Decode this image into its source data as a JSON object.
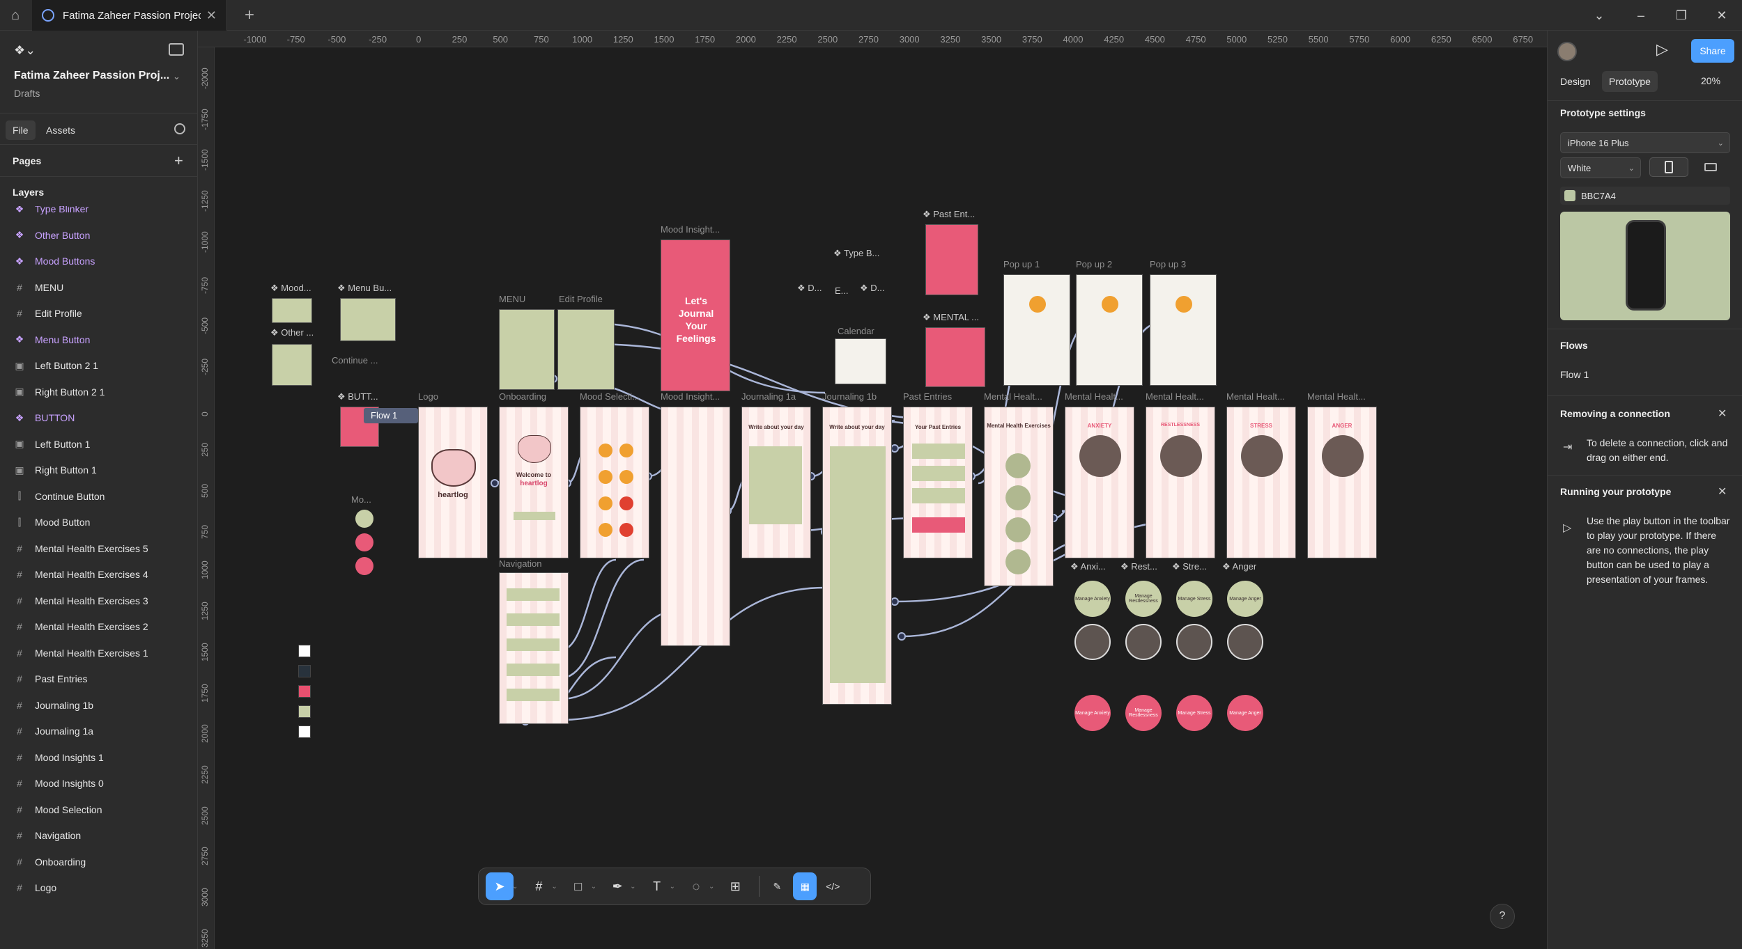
{
  "titlebar": {
    "tab_title": "Fatima Zaheer Passion Project G",
    "win_min": "–",
    "win_restore": "❐",
    "win_close": "✕",
    "win_dropdown": "⌄"
  },
  "left_panel": {
    "file_title": "Fatima Zaheer Passion Proj...",
    "file_subtitle": "Drafts",
    "tabs": [
      "File",
      "Assets"
    ],
    "pages_label": "Pages",
    "layers_label": "Layers",
    "layers": [
      {
        "name": "Type Blinker",
        "type": "component"
      },
      {
        "name": "Other Button",
        "type": "component"
      },
      {
        "name": "Mood Buttons",
        "type": "component"
      },
      {
        "name": "MENU",
        "type": "frame"
      },
      {
        "name": "Edit Profile",
        "type": "frame"
      },
      {
        "name": "Menu Button",
        "type": "component"
      },
      {
        "name": "Left Button 2 1",
        "type": "group"
      },
      {
        "name": "Right Button 2 1",
        "type": "group"
      },
      {
        "name": "BUTTON",
        "type": "component"
      },
      {
        "name": "Left Button 1",
        "type": "group"
      },
      {
        "name": "Right Button 1",
        "type": "group"
      },
      {
        "name": "Continue Button",
        "type": "autolayout"
      },
      {
        "name": "Mood Button",
        "type": "autolayout"
      },
      {
        "name": "Mental Health Exercises 5",
        "type": "frame"
      },
      {
        "name": "Mental Health Exercises 4",
        "type": "frame"
      },
      {
        "name": "Mental Health Exercises 3",
        "type": "frame"
      },
      {
        "name": "Mental Health Exercises 2",
        "type": "frame"
      },
      {
        "name": "Mental Health Exercises 1",
        "type": "frame"
      },
      {
        "name": "Past Entries",
        "type": "frame"
      },
      {
        "name": "Journaling 1b",
        "type": "frame"
      },
      {
        "name": "Journaling 1a",
        "type": "frame"
      },
      {
        "name": "Mood Insights 1",
        "type": "frame"
      },
      {
        "name": "Mood Insights 0",
        "type": "frame"
      },
      {
        "name": "Mood Selection",
        "type": "frame"
      },
      {
        "name": "Navigation",
        "type": "frame"
      },
      {
        "name": "Onboarding",
        "type": "frame"
      },
      {
        "name": "Logo",
        "type": "frame"
      }
    ]
  },
  "canvas": {
    "ruler_top": [
      "-1000",
      "-750",
      "-500",
      "-250",
      "0",
      "250",
      "500",
      "750",
      "1000",
      "1250",
      "1500",
      "1750",
      "2000",
      "2250",
      "2500",
      "2750",
      "3000",
      "3250",
      "3500",
      "3750",
      "4000",
      "4250",
      "4500",
      "4750",
      "5000",
      "5250",
      "5500",
      "5750",
      "6000",
      "6250",
      "6500",
      "6750"
    ],
    "ruler_left": [
      "-2000",
      "-1750",
      "-1500",
      "-1250",
      "-1000",
      "-750",
      "-500",
      "-250",
      "0",
      "250",
      "500",
      "750",
      "1000",
      "1250",
      "1500",
      "1750",
      "2000",
      "2250",
      "2500",
      "2750",
      "3000",
      "3250"
    ],
    "flow_badge": "Flow 1",
    "frame_labels": {
      "logo": "Logo",
      "onboarding": "Onboarding",
      "mood_selection": "Mood Selecti...",
      "mood_insights": "Mood Insight...",
      "mood_insights_top": "Mood Insight...",
      "journaling_1a": "Journaling 1a",
      "journaling_1b": "Journaling 1b",
      "past_entries": "Past Entries",
      "mh1": "Mental Healt...",
      "mh2": "Mental Healt...",
      "mh3": "Mental Healt...",
      "mh4": "Mental Healt...",
      "mh5": "Mental Healt...",
      "menu": "MENU",
      "edit_profile": "Edit Profile",
      "navigation": "Navigation",
      "calendar": "Calendar",
      "popup1": "Pop up 1",
      "popup2": "Pop up 2",
      "popup3": "Pop up 3",
      "continue": "Continue ...",
      "mo": "Mo..."
    },
    "component_labels": {
      "mood": "❖ Mood...",
      "menu_bu": "❖ Menu Bu...",
      "other": "❖ Other ...",
      "butt": "❖ BUTT...",
      "past_ent": "❖ Past Ent...",
      "mental": "❖ MENTAL ...",
      "type_b": "❖ Type B...",
      "d1": "❖ D...",
      "d2": "❖ D...",
      "e": "E...",
      "anxi": "❖ Anxi...",
      "rest": "❖ Rest...",
      "stre": "❖ Stre...",
      "anger": "❖ Anger"
    },
    "frame_texts": {
      "heartlog": "heartlog",
      "welcome": "Welcome to",
      "journal_title": "Let's Journal Your Feelings",
      "past_title": "Your Past Entries",
      "anxiety": "ANXIETY",
      "restlessness": "RESTLESSNESS",
      "stress": "STRESS",
      "anger": "ANGER",
      "mh_exercises": "Mental Health Exercises",
      "write_day": "Write about your day",
      "manage_anxiety": "Manage Anxiety",
      "manage_restlessness": "Manage Restlessness",
      "manage_stress": "Manage Stress",
      "manage_anger": "Manage Anger"
    },
    "swatch_colors": [
      "#ffffff",
      "#28323c",
      "#e8506f",
      "#c8d0a8",
      "#ffffff"
    ]
  },
  "toolbar": {
    "tools": [
      {
        "name": "move",
        "glyph": "➤"
      },
      {
        "name": "frame",
        "glyph": "#"
      },
      {
        "name": "rectangle",
        "glyph": "□"
      },
      {
        "name": "pen",
        "glyph": "✒"
      },
      {
        "name": "text",
        "glyph": "T"
      },
      {
        "name": "shape",
        "glyph": "◌"
      },
      {
        "name": "actions",
        "glyph": "⊞"
      }
    ],
    "mode_tools": [
      {
        "name": "draw",
        "glyph": "✎"
      },
      {
        "name": "design",
        "glyph": "▦"
      },
      {
        "name": "dev",
        "glyph": "</>"
      }
    ],
    "help": "?"
  },
  "right_panel": {
    "share_label": "Share",
    "tabs": [
      "Design",
      "Prototype"
    ],
    "zoom": "20%",
    "settings_heading": "Prototype settings",
    "device": "iPhone 16 Plus",
    "device_color": "White",
    "bg_color_hex": "BBC7A4",
    "bg_color": "#BBC7A4",
    "flows_heading": "Flows",
    "flow_name": "Flow 1",
    "removing_heading": "Removing a connection",
    "removing_text": "To delete a connection, click and drag on either end.",
    "running_heading": "Running your prototype",
    "running_text": "Use the play button in the toolbar to play your prototype. If there are no connections, the play button can be used to play a presentation of your frames."
  },
  "colors": {
    "accent": "#4c9ffe",
    "component": "#c8a2ff",
    "pink": "#e85a78",
    "sage": "#c8d0a8",
    "wire": "#aab6d8"
  }
}
